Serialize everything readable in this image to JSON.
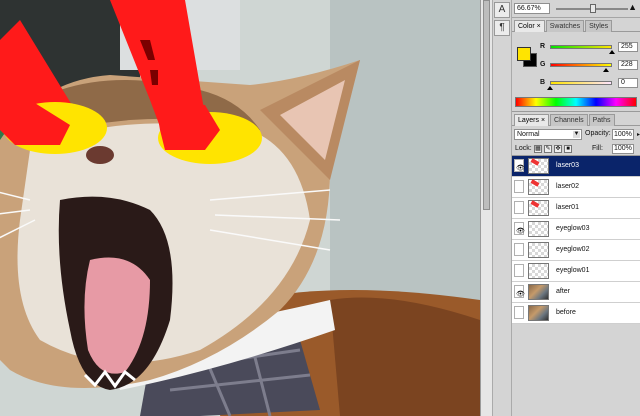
{
  "navigator": {
    "zoom": "66.67%"
  },
  "color_panel": {
    "tabs": [
      "Color ×",
      "Swatches",
      "Styles"
    ],
    "foreground_color": "#ffe400",
    "background_color": "#000000",
    "channels": [
      {
        "label": "R",
        "value": "255"
      },
      {
        "label": "G",
        "value": "228"
      },
      {
        "label": "B",
        "value": "0"
      }
    ]
  },
  "layers_panel": {
    "tabs": [
      "Layers ×",
      "Channels",
      "Paths"
    ],
    "blend_mode": "Normal",
    "opacity_label": "Opacity:",
    "opacity_value": "100%",
    "lock_label": "Lock:",
    "fill_label": "Fill:",
    "fill_value": "100%",
    "layers": [
      {
        "name": "laser03",
        "visible": true,
        "selected": true
      },
      {
        "name": "laser02",
        "visible": false,
        "selected": false
      },
      {
        "name": "laser01",
        "visible": false,
        "selected": false
      },
      {
        "name": "eyeglow03",
        "visible": true,
        "selected": false
      },
      {
        "name": "eyeglow02",
        "visible": false,
        "selected": false
      },
      {
        "name": "eyeglow01",
        "visible": false,
        "selected": false
      },
      {
        "name": "after",
        "visible": true,
        "selected": false
      },
      {
        "name": "before",
        "visible": false,
        "selected": false
      }
    ]
  },
  "accent_colors": {
    "laser_red": "#ff1a1a",
    "eyeglow_yellow": "#ffe400",
    "selection": "#0a246a"
  }
}
